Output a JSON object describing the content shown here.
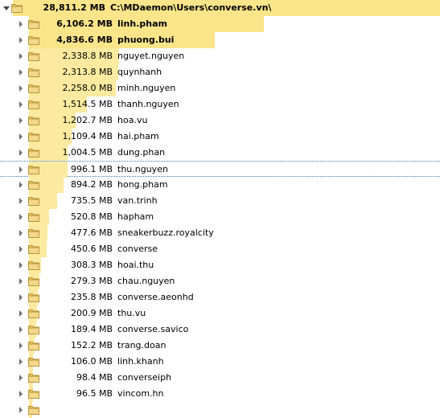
{
  "root": {
    "size": "28,811.2 MB",
    "path": "C:\\MDaemon\\Users\\converse.vn\\",
    "fill_percent": 100
  },
  "colors": {
    "bar": "#fbeaa0",
    "bar_bold": "#fbe58a",
    "folder": "#e8c86a",
    "selection_border": "#3c7fb1"
  },
  "icons": {
    "expander_collapsed": "chevron-right-icon",
    "expander_expanded": "chevron-down-icon",
    "folder": "folder-icon"
  },
  "selected_index": 9,
  "items": [
    {
      "size": "6,106.2 MB",
      "name": "linh.pham",
      "fill_percent": 100,
      "bold": true
    },
    {
      "size": "4,836.6 MB",
      "name": "phuong.bui",
      "fill_percent": 79.2,
      "bold": true
    },
    {
      "size": "2,338.8 MB",
      "name": "nguyet.nguyen",
      "fill_percent": 38.3
    },
    {
      "size": "2,313.8 MB",
      "name": "quynhanh",
      "fill_percent": 37.9
    },
    {
      "size": "2,258.0 MB",
      "name": "minh.nguyen",
      "fill_percent": 37.0
    },
    {
      "size": "1,514.5 MB",
      "name": "thanh.nguyen",
      "fill_percent": 24.8
    },
    {
      "size": "1,202.7 MB",
      "name": "hoa.vu",
      "fill_percent": 19.7
    },
    {
      "size": "1,109.4 MB",
      "name": "hai.pham",
      "fill_percent": 18.2
    },
    {
      "size": "1,004.5 MB",
      "name": "dung.phan",
      "fill_percent": 16.5
    },
    {
      "size": "996.1 MB",
      "name": "thu.nguyen",
      "fill_percent": 16.3
    },
    {
      "size": "894.2 MB",
      "name": "hong.pham",
      "fill_percent": 14.6
    },
    {
      "size": "735.5 MB",
      "name": "van.trinh",
      "fill_percent": 12.0
    },
    {
      "size": "520.8 MB",
      "name": "hapham",
      "fill_percent": 8.5
    },
    {
      "size": "477.6 MB",
      "name": "sneakerbuzz.royalcity",
      "fill_percent": 7.8
    },
    {
      "size": "450.6 MB",
      "name": "converse",
      "fill_percent": 7.4
    },
    {
      "size": "308.3 MB",
      "name": "hoai.thu",
      "fill_percent": 5.0
    },
    {
      "size": "279.3 MB",
      "name": "chau.nguyen",
      "fill_percent": 4.6
    },
    {
      "size": "235.8 MB",
      "name": "converse.aeonhd",
      "fill_percent": 3.9
    },
    {
      "size": "200.9 MB",
      "name": "thu.vu",
      "fill_percent": 3.3
    },
    {
      "size": "189.4 MB",
      "name": "converse.savico",
      "fill_percent": 3.1
    },
    {
      "size": "152.2 MB",
      "name": "trang.doan",
      "fill_percent": 2.5
    },
    {
      "size": "106.0 MB",
      "name": "linh.khanh",
      "fill_percent": 1.7
    },
    {
      "size": "98.4 MB",
      "name": "converseiph",
      "fill_percent": 1.6
    },
    {
      "size": "96.5 MB",
      "name": "vincom.hn",
      "fill_percent": 1.6
    },
    {
      "size": "",
      "name": "",
      "fill_percent": 1.5
    }
  ]
}
